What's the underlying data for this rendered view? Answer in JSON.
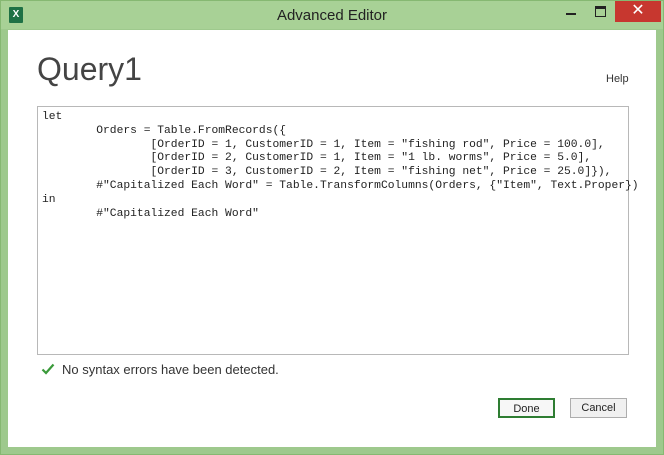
{
  "window": {
    "title": "Advanced Editor",
    "app_icon_label": "X",
    "app_icon": "excel-icon",
    "close_glyph": "✕"
  },
  "header": {
    "query_name": "Query1",
    "help_label": "Help"
  },
  "editor": {
    "code": "let\n        Orders = Table.FromRecords({\n                [OrderID = 1, CustomerID = 1, Item = \"fishing rod\", Price = 100.0],\n                [OrderID = 2, CustomerID = 1, Item = \"1 lb. worms\", Price = 5.0],\n                [OrderID = 3, CustomerID = 2, Item = \"fishing net\", Price = 25.0]}),\n        #\"Capitalized Each Word\" = Table.TransformColumns(Orders, {\"Item\", Text.Proper})\nin\n        #\"Capitalized Each Word\""
  },
  "status": {
    "icon": "check-icon",
    "text": "No syntax errors have been detected.",
    "color": "#3a9a3a"
  },
  "footer": {
    "done_label": "Done",
    "cancel_label": "Cancel"
  }
}
